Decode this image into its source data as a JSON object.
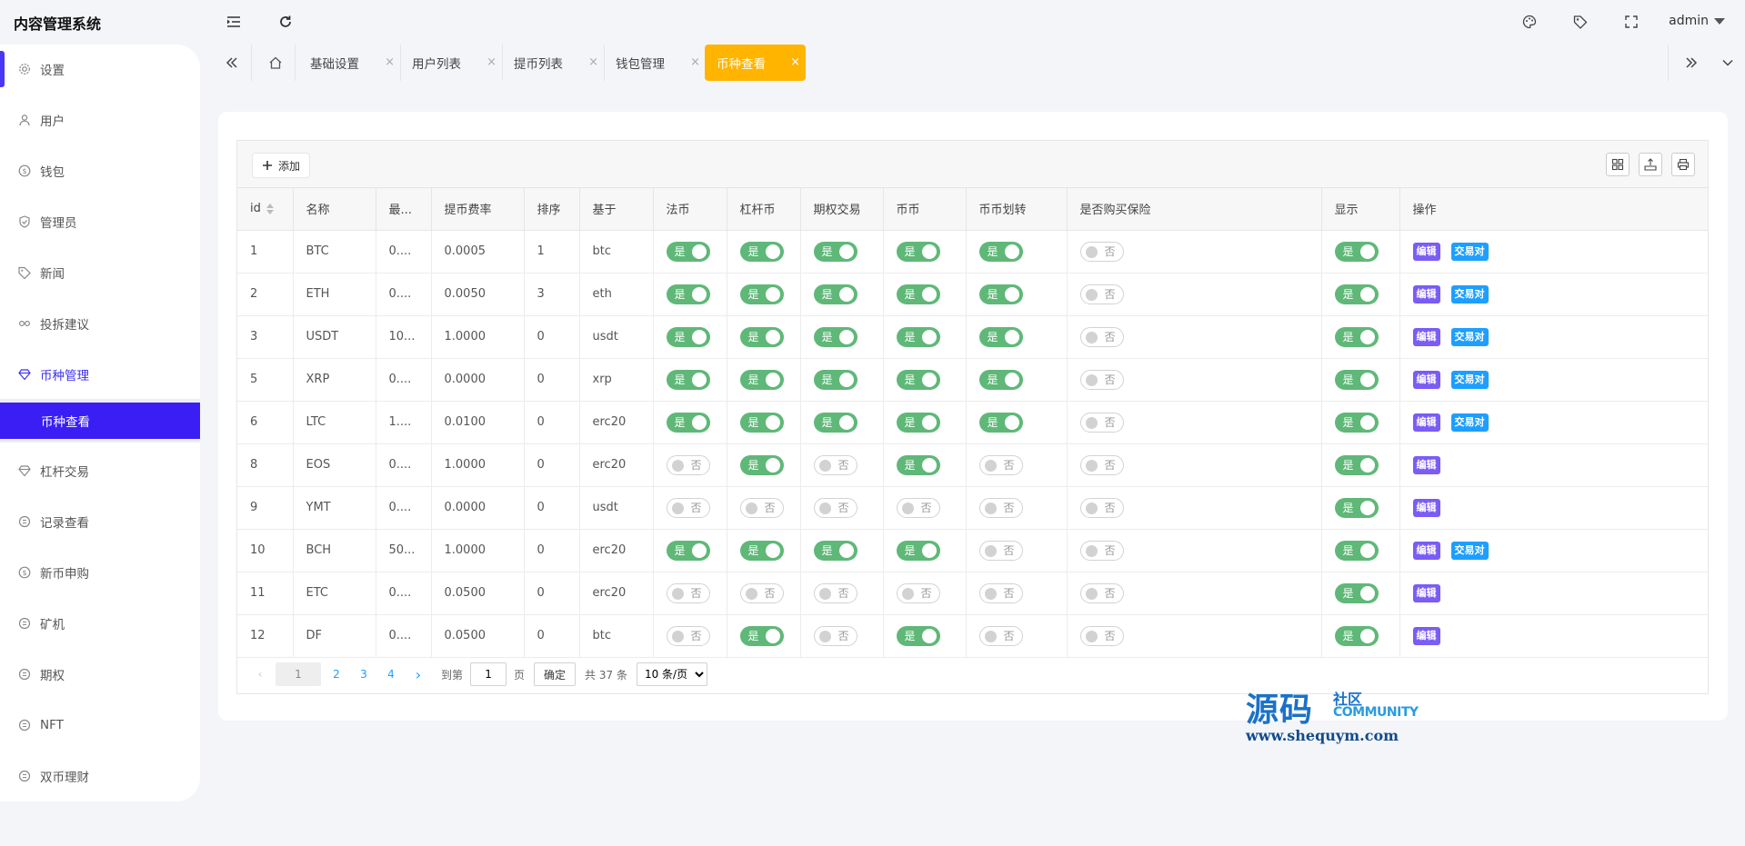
{
  "app": {
    "title": "内容管理系统",
    "user": "admin"
  },
  "sidebar": {
    "items": [
      {
        "label": "设置",
        "icon": "gear-icon"
      },
      {
        "label": "用户",
        "icon": "user-icon"
      },
      {
        "label": "钱包",
        "icon": "coin-icon"
      },
      {
        "label": "管理员",
        "icon": "shield-icon"
      },
      {
        "label": "新闻",
        "icon": "tag-icon"
      },
      {
        "label": "投拆建议",
        "icon": "link-icon"
      },
      {
        "label": "币种管理",
        "icon": "diamond-icon"
      },
      {
        "label": "币种查看",
        "icon": ""
      },
      {
        "label": "杠杆交易",
        "icon": "diamond-icon"
      },
      {
        "label": "记录查看",
        "icon": "cycle-icon"
      },
      {
        "label": "新币申购",
        "icon": "coin-icon"
      },
      {
        "label": "矿机",
        "icon": "cycle-icon"
      },
      {
        "label": "期权",
        "icon": "cycle-icon"
      },
      {
        "label": "NFT",
        "icon": "cycle-icon"
      },
      {
        "label": "双币理财",
        "icon": "cycle-icon"
      }
    ]
  },
  "tabs": [
    {
      "label": "基础设置",
      "close": "×"
    },
    {
      "label": "用户列表",
      "close": "×"
    },
    {
      "label": "提币列表",
      "close": "×"
    },
    {
      "label": "钱包管理",
      "close": "×"
    },
    {
      "label": "币种查看",
      "close": "×"
    }
  ],
  "toolbar": {
    "add_label": "添加"
  },
  "table": {
    "columns": [
      "id",
      "名称",
      "最...",
      "提币费率",
      "排序",
      "基于",
      "法币",
      "杠杆币",
      "期权交易",
      "币币",
      "币币划转",
      "是否购买保险",
      "显示",
      "操作"
    ],
    "on_label": "是",
    "off_label": "否",
    "edit_label": "编辑",
    "pair_label": "交易对",
    "rows": [
      {
        "id": "1",
        "name": "BTC",
        "min": "0....",
        "fee": "0.0005",
        "sort": "1",
        "base": "btc",
        "fiat": true,
        "lever": true,
        "option": true,
        "coin": true,
        "transfer": true,
        "insurance": false,
        "show": true,
        "pair": true
      },
      {
        "id": "2",
        "name": "ETH",
        "min": "0....",
        "fee": "0.0050",
        "sort": "3",
        "base": "eth",
        "fiat": true,
        "lever": true,
        "option": true,
        "coin": true,
        "transfer": true,
        "insurance": false,
        "show": true,
        "pair": true
      },
      {
        "id": "3",
        "name": "USDT",
        "min": "10...",
        "fee": "1.0000",
        "sort": "0",
        "base": "usdt",
        "fiat": true,
        "lever": true,
        "option": true,
        "coin": true,
        "transfer": true,
        "insurance": false,
        "show": true,
        "pair": true
      },
      {
        "id": "5",
        "name": "XRP",
        "min": "0....",
        "fee": "0.0000",
        "sort": "0",
        "base": "xrp",
        "fiat": true,
        "lever": true,
        "option": true,
        "coin": true,
        "transfer": true,
        "insurance": false,
        "show": true,
        "pair": true
      },
      {
        "id": "6",
        "name": "LTC",
        "min": "1....",
        "fee": "0.0100",
        "sort": "0",
        "base": "erc20",
        "fiat": true,
        "lever": true,
        "option": true,
        "coin": true,
        "transfer": true,
        "insurance": false,
        "show": true,
        "pair": true
      },
      {
        "id": "8",
        "name": "EOS",
        "min": "0....",
        "fee": "1.0000",
        "sort": "0",
        "base": "erc20",
        "fiat": false,
        "lever": true,
        "option": false,
        "coin": true,
        "transfer": false,
        "insurance": false,
        "show": true,
        "pair": false
      },
      {
        "id": "9",
        "name": "YMT",
        "min": "0....",
        "fee": "0.0000",
        "sort": "0",
        "base": "usdt",
        "fiat": false,
        "lever": false,
        "option": false,
        "coin": false,
        "transfer": false,
        "insurance": false,
        "show": true,
        "pair": false
      },
      {
        "id": "10",
        "name": "BCH",
        "min": "50...",
        "fee": "1.0000",
        "sort": "0",
        "base": "erc20",
        "fiat": true,
        "lever": true,
        "option": true,
        "coin": true,
        "transfer": false,
        "insurance": false,
        "show": true,
        "pair": true
      },
      {
        "id": "11",
        "name": "ETC",
        "min": "0....",
        "fee": "0.0500",
        "sort": "0",
        "base": "erc20",
        "fiat": false,
        "lever": false,
        "option": false,
        "coin": false,
        "transfer": false,
        "insurance": false,
        "show": true,
        "pair": false
      },
      {
        "id": "12",
        "name": "DF",
        "min": "0....",
        "fee": "0.0500",
        "sort": "0",
        "base": "btc",
        "fiat": false,
        "lever": true,
        "option": false,
        "coin": true,
        "transfer": false,
        "insurance": false,
        "show": true,
        "pair": false
      }
    ]
  },
  "pagination": {
    "prev": "‹",
    "next": "›",
    "current": "1",
    "pages": [
      "2",
      "3",
      "4"
    ],
    "goto_label": "到第",
    "goto_value": "1",
    "page_unit": "页",
    "confirm_label": "确定",
    "total_label": "共 37 条",
    "page_size": "10 条/页"
  },
  "watermark": {
    "big": "源码",
    "small": "社区",
    "community": "COMMUNITY",
    "url": "www.shequym.com"
  },
  "colors": {
    "accent": "#3a1ef4",
    "active_tab": "#ffb400",
    "switch_on": "#5fb878",
    "edit": "#7b5cf5",
    "pair": "#1e9fff"
  }
}
